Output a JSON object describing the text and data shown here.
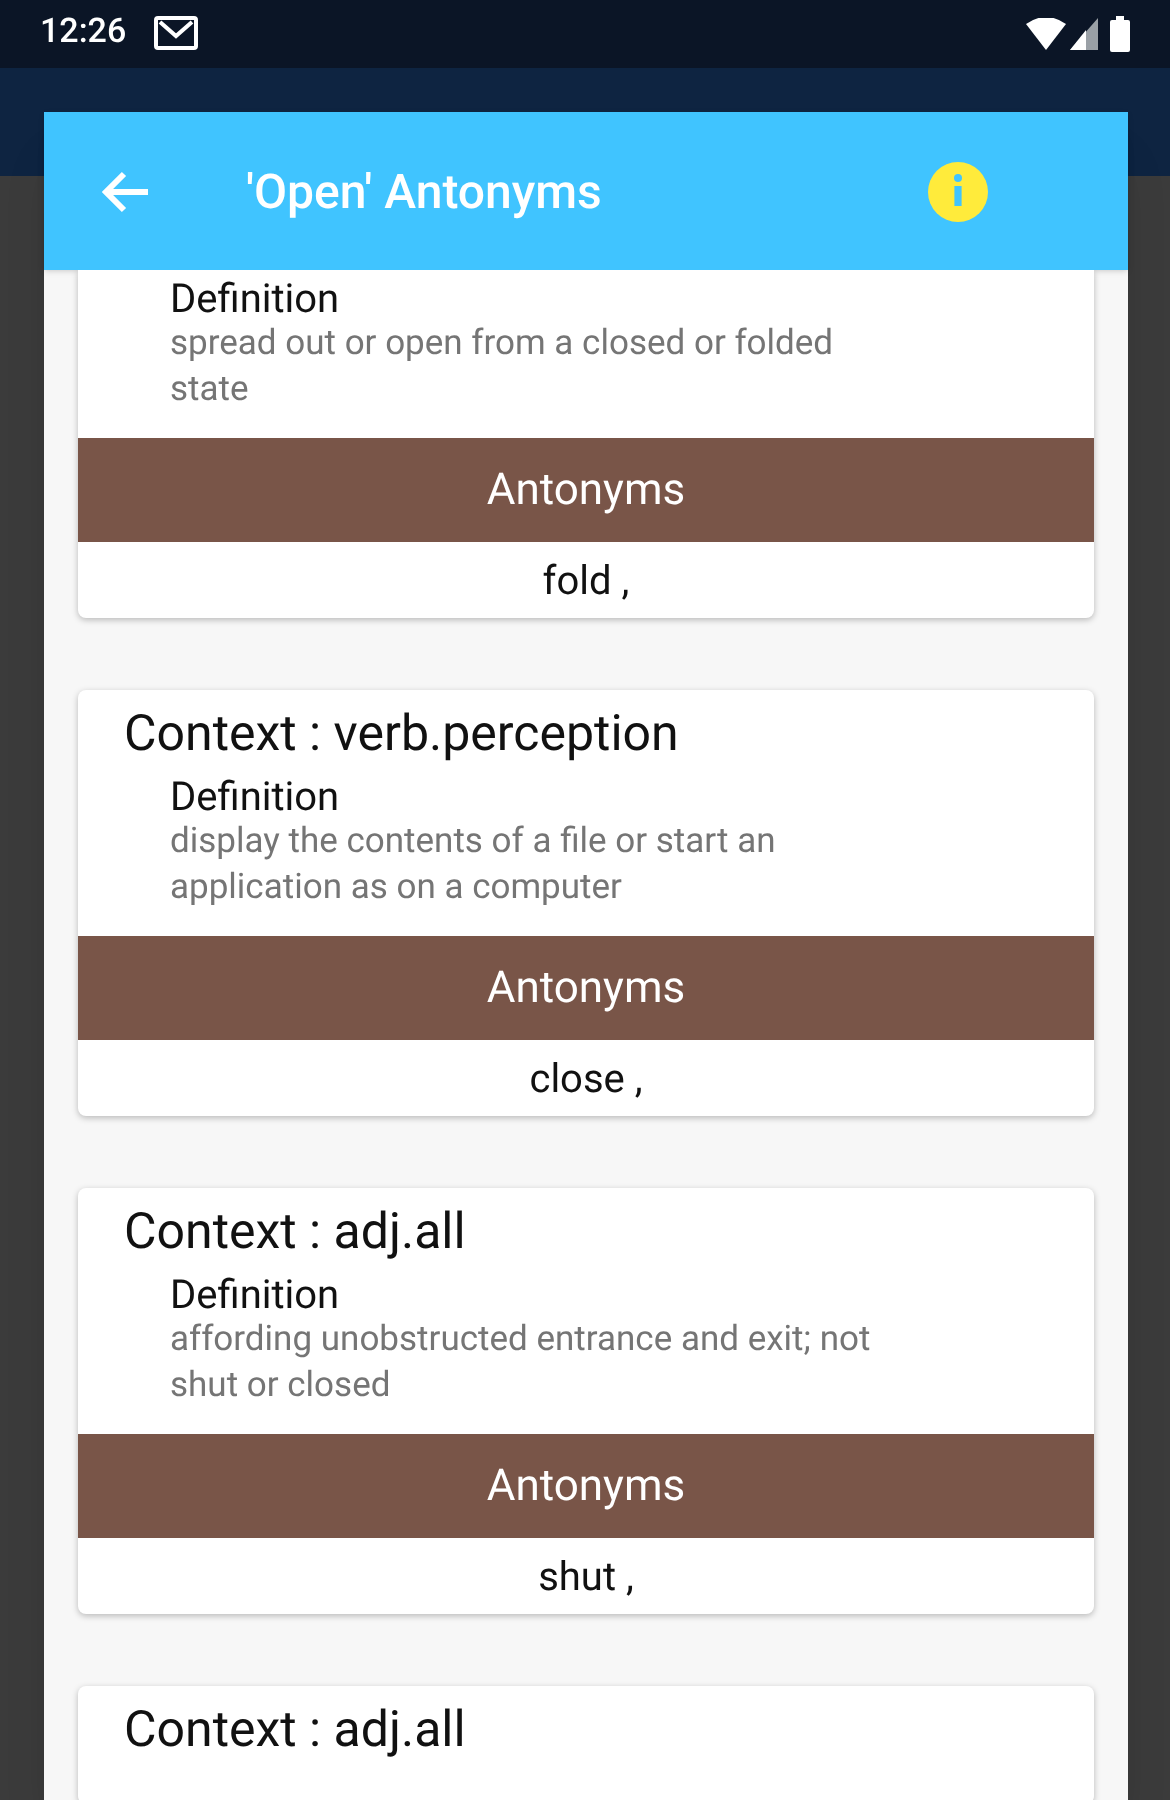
{
  "status_bar": {
    "time": "12:26"
  },
  "dialog": {
    "title": "'Open' Antonyms"
  },
  "cards": [
    {
      "definition_label": "Definition",
      "definition": "spread out or open from a closed or folded state",
      "section_label": "Antonyms",
      "antonyms": "fold ,"
    },
    {
      "context": "Context : verb.perception",
      "definition_label": "Definition",
      "definition": "display the contents of a file or start an application as on a computer",
      "section_label": "Antonyms",
      "antonyms": "close ,"
    },
    {
      "context": "Context : adj.all",
      "definition_label": "Definition",
      "definition": "affording unobstructed entrance and exit; not shut or closed",
      "section_label": "Antonyms",
      "antonyms": "shut ,"
    },
    {
      "context": "Context : adj.all"
    }
  ]
}
